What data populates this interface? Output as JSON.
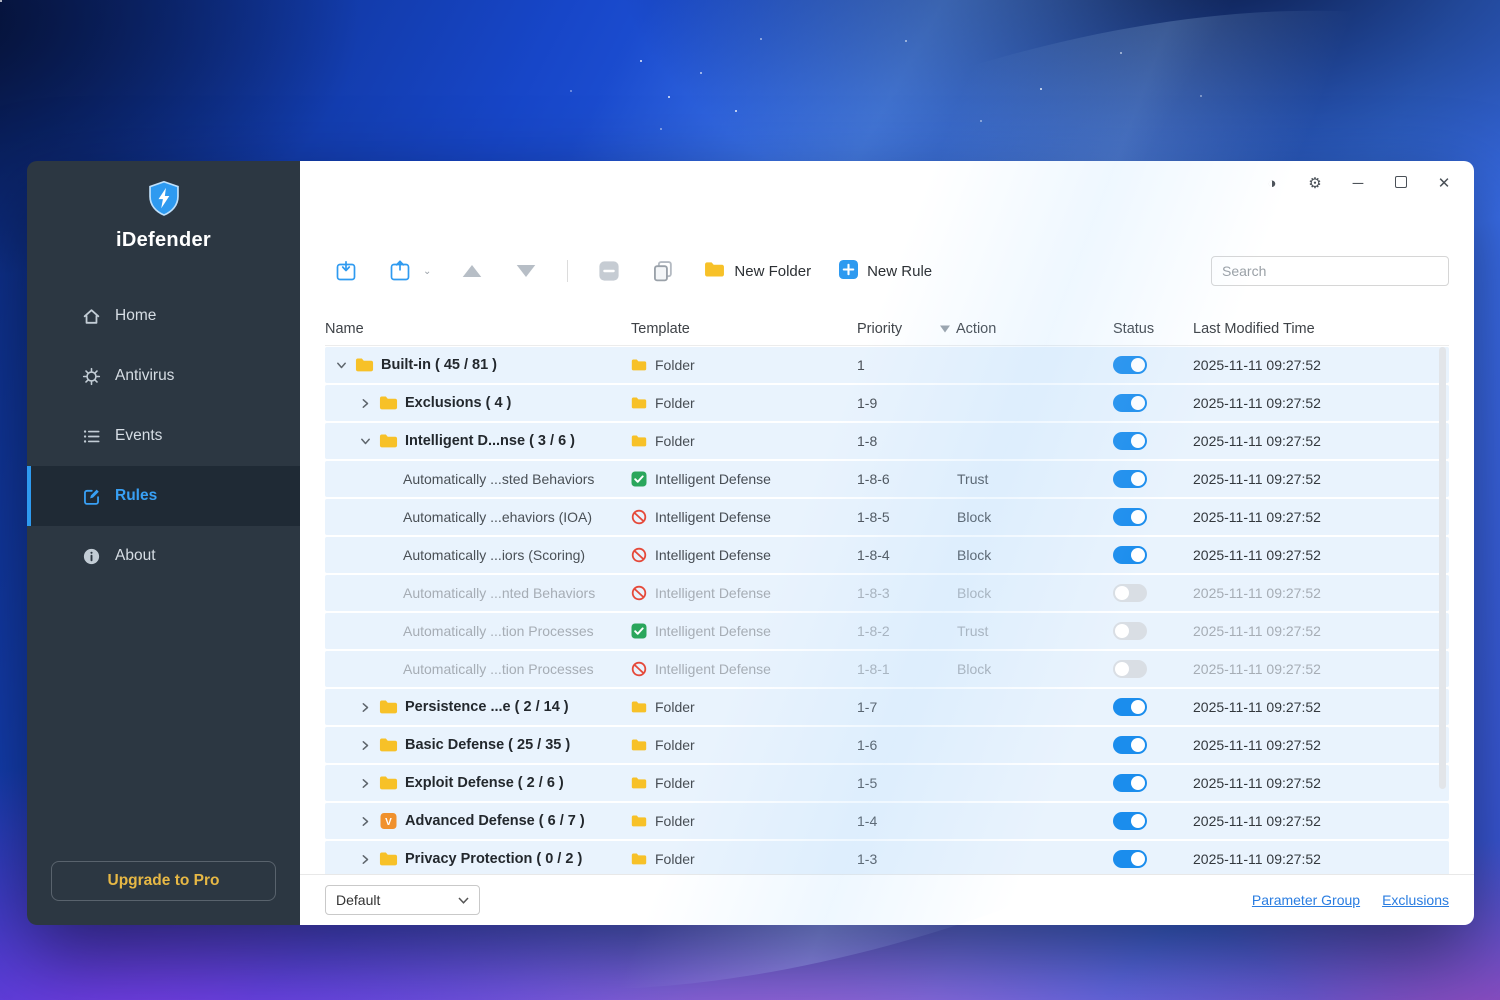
{
  "sidebar": {
    "app_name": "iDefender",
    "items": [
      {
        "label": "Home",
        "icon": "home-icon",
        "active": false
      },
      {
        "label": "Antivirus",
        "icon": "antivirus-icon",
        "active": false
      },
      {
        "label": "Events",
        "icon": "events-icon",
        "active": false
      },
      {
        "label": "Rules",
        "icon": "rules-icon",
        "active": true
      },
      {
        "label": "About",
        "icon": "about-icon",
        "active": false
      }
    ],
    "upgrade_button": "Upgrade to Pro"
  },
  "titlebar": {
    "buttons": [
      "theme-contrast",
      "settings-gear",
      "minimize",
      "maximize",
      "close"
    ]
  },
  "toolbar": {
    "new_folder": "New Folder",
    "new_rule": "New Rule",
    "search_placeholder": "Search"
  },
  "table": {
    "columns": [
      "Name",
      "Template",
      "Priority",
      "Action",
      "Status",
      "Last Modified Time"
    ],
    "rows": [
      {
        "indent": 0,
        "expander": "down",
        "name_icon": "folder",
        "name": "Built-in ( 45 / 81 )",
        "bold": true,
        "template_icon": "folder",
        "template": "Folder",
        "priority": "1",
        "action": "",
        "enabled": true,
        "dimmed": false,
        "modified": "2025-11-11 09:27:52"
      },
      {
        "indent": 1,
        "expander": "right",
        "name_icon": "folder",
        "name": "Exclusions ( 4 )",
        "bold": true,
        "template_icon": "folder",
        "template": "Folder",
        "priority": "1-9",
        "action": "",
        "enabled": true,
        "dimmed": false,
        "modified": "2025-11-11 09:27:52"
      },
      {
        "indent": 1,
        "expander": "down",
        "name_icon": "folder",
        "name": "Intelligent D...nse ( 3 / 6 )",
        "bold": true,
        "template_icon": "folder",
        "template": "Folder",
        "priority": "1-8",
        "action": "",
        "enabled": true,
        "dimmed": false,
        "modified": "2025-11-11 09:27:52"
      },
      {
        "indent": 2,
        "expander": null,
        "name_icon": null,
        "name": "Automatically ...sted Behaviors",
        "bold": false,
        "template_icon": "check",
        "template": "Intelligent Defense",
        "priority": "1-8-6",
        "action": "Trust",
        "enabled": true,
        "dimmed": false,
        "modified": "2025-11-11 09:27:52"
      },
      {
        "indent": 2,
        "expander": null,
        "name_icon": null,
        "name": "Automatically ...ehaviors (IOA)",
        "bold": false,
        "template_icon": "block",
        "template": "Intelligent Defense",
        "priority": "1-8-5",
        "action": "Block",
        "enabled": true,
        "dimmed": false,
        "modified": "2025-11-11 09:27:52"
      },
      {
        "indent": 2,
        "expander": null,
        "name_icon": null,
        "name": "Automatically ...iors (Scoring)",
        "bold": false,
        "template_icon": "block",
        "template": "Intelligent Defense",
        "priority": "1-8-4",
        "action": "Block",
        "enabled": true,
        "dimmed": false,
        "modified": "2025-11-11 09:27:52"
      },
      {
        "indent": 2,
        "expander": null,
        "name_icon": null,
        "name": "Automatically ...nted Behaviors",
        "bold": false,
        "template_icon": "block",
        "template": "Intelligent Defense",
        "priority": "1-8-3",
        "action": "Block",
        "enabled": false,
        "dimmed": true,
        "modified": "2025-11-11 09:27:52"
      },
      {
        "indent": 2,
        "expander": null,
        "name_icon": null,
        "name": "Automatically ...tion Processes",
        "bold": false,
        "template_icon": "check",
        "template": "Intelligent Defense",
        "priority": "1-8-2",
        "action": "Trust",
        "enabled": false,
        "dimmed": true,
        "modified": "2025-11-11 09:27:52"
      },
      {
        "indent": 2,
        "expander": null,
        "name_icon": null,
        "name": "Automatically ...tion Processes",
        "bold": false,
        "template_icon": "block",
        "template": "Intelligent Defense",
        "priority": "1-8-1",
        "action": "Block",
        "enabled": false,
        "dimmed": true,
        "modified": "2025-11-11 09:27:52"
      },
      {
        "indent": 1,
        "expander": "right",
        "name_icon": "folder",
        "name": "Persistence ...e ( 2 / 14 )",
        "bold": true,
        "template_icon": "folder",
        "template": "Folder",
        "priority": "1-7",
        "action": "",
        "enabled": true,
        "dimmed": false,
        "modified": "2025-11-11 09:27:52"
      },
      {
        "indent": 1,
        "expander": "right",
        "name_icon": "folder",
        "name": "Basic Defense ( 25 / 35 )",
        "bold": true,
        "template_icon": "folder",
        "template": "Folder",
        "priority": "1-6",
        "action": "",
        "enabled": true,
        "dimmed": false,
        "modified": "2025-11-11 09:27:52"
      },
      {
        "indent": 1,
        "expander": "right",
        "name_icon": "folder",
        "name": "Exploit Defense ( 2 / 6 )",
        "bold": true,
        "template_icon": "folder",
        "template": "Folder",
        "priority": "1-5",
        "action": "",
        "enabled": true,
        "dimmed": false,
        "modified": "2025-11-11 09:27:52"
      },
      {
        "indent": 1,
        "expander": "right",
        "name_icon": "vfolder",
        "name": "Advanced Defense ( 6 / 7 )",
        "bold": true,
        "template_icon": "folder",
        "template": "Folder",
        "priority": "1-4",
        "action": "",
        "enabled": true,
        "dimmed": false,
        "modified": "2025-11-11 09:27:52"
      },
      {
        "indent": 1,
        "expander": "right",
        "name_icon": "folder",
        "name": "Privacy Protection ( 0 / 2 )",
        "bold": true,
        "template_icon": "folder",
        "template": "Folder",
        "priority": "1-3",
        "action": "",
        "enabled": true,
        "dimmed": false,
        "modified": "2025-11-11 09:27:52"
      }
    ]
  },
  "footer": {
    "group_select": "Default",
    "links": [
      "Parameter Group",
      "Exclusions"
    ]
  },
  "colors": {
    "accent": "#2e9af0",
    "toggle_on": "#1b8ded",
    "link": "#2a7de1",
    "row_bg": "#e9f3fd",
    "sidebar_bg": "#2c3742",
    "upgrade_text": "#e7b845"
  }
}
